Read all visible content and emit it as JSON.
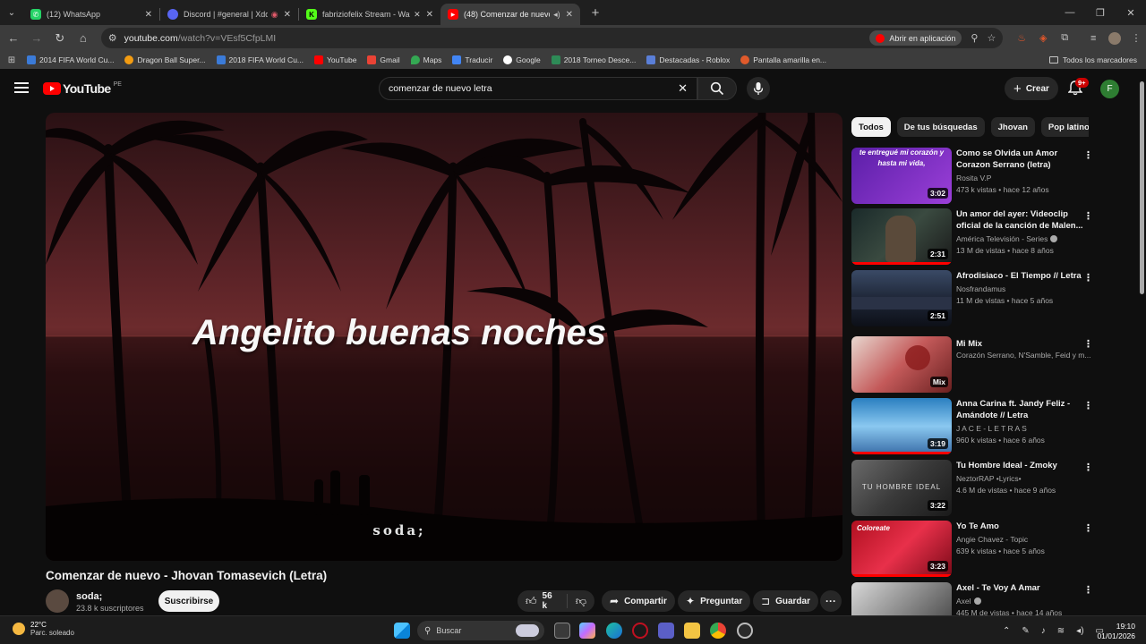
{
  "browser": {
    "tabs": [
      {
        "title": "(12) WhatsApp",
        "color": "#25d366",
        "glyph": "W",
        "extra": ""
      },
      {
        "title": "Discord | #general | Xddd",
        "color": "#5865f2",
        "glyph": "D",
        "extra": "◉"
      },
      {
        "title": "fabriziofelix Stream - Watch",
        "color": "#53fc18",
        "glyph": "K",
        "extra": "🔇"
      },
      {
        "title": "(48) Comenzar de nuevo - J",
        "color": "#ff0000",
        "glyph": "▶",
        "extra": "🔊"
      }
    ],
    "url_host": "youtube.com",
    "url_path": "/watch?v=VEsf5CfpLMI",
    "open_in_app": "Abrir en aplicación",
    "bookmarks": [
      {
        "label": "2014 FIFA World Cu...",
        "color": "#3b7bd8"
      },
      {
        "label": "Dragon Ball Super...",
        "color": "#f39c12"
      },
      {
        "label": "2018 FIFA World Cu...",
        "color": "#3b7bd8"
      },
      {
        "label": "YouTube",
        "color": "#ff0000"
      },
      {
        "label": "Gmail",
        "color": "#ea4335"
      },
      {
        "label": "Maps",
        "color": "#34a853"
      },
      {
        "label": "Traducir",
        "color": "#4285f4"
      },
      {
        "label": "Google",
        "color": "#ffffff"
      },
      {
        "label": "2018 Torneo Desce...",
        "color": "#2e8b57"
      },
      {
        "label": "Destacadas - Roblox",
        "color": "#5a7fd8"
      },
      {
        "label": "Pantalla amarilla en...",
        "color": "#e05a2b"
      }
    ],
    "all_bookmarks": "Todos los marcadores"
  },
  "youtube": {
    "logo": "YouTube",
    "country": "PE",
    "search_query": "comenzar de nuevo letra",
    "create_label": "Crear",
    "notifications": "9+",
    "avatar_letter": "F",
    "video": {
      "lyric": "Angelito buenas noches",
      "watermark": "soda;",
      "title": "Comenzar de nuevo - Jhovan Tomasevich (Letra)",
      "channel": "soda;",
      "subscribers": "23.8 k suscriptores",
      "subscribe_label": "Suscribirse",
      "likes": "56 k",
      "share_label": "Compartir",
      "ask_label": "Preguntar",
      "save_label": "Guardar"
    },
    "chips": [
      "Todos",
      "De tus búsquedas",
      "Jhovan",
      "Pop latino"
    ],
    "recommendations": [
      {
        "title": "Como se Olvida un Amor Corazon Serrano (letra) Primic...",
        "meta1": "Rosita V.P",
        "meta2": "473 k vistas • hace 12 años",
        "duration": "3:02",
        "verified": false,
        "thumb_bg": "linear-gradient(135deg,#5b1fa8,#9b3fd8)",
        "thumb_text": "te entregué mi corazón y hasta mi vida,"
      },
      {
        "title": "Un amor del ayer: Videoclip oficial de la canción de Malen...",
        "meta1": "América Televisión - Series",
        "meta2": "13 M de vistas • hace 8 años",
        "duration": "2:31",
        "verified": true,
        "thumb_bg": "linear-gradient(135deg,#1a2a2a,#3a4a40,#1a1a1a)",
        "thumb_text": ""
      },
      {
        "title": "Afrodisiaco - El Tiempo // Letra",
        "meta1": "Nosfrandamus",
        "meta2": "11 M de vistas • hace 5 años",
        "duration": "2:51",
        "verified": false,
        "thumb_bg": "linear-gradient(180deg,#3a4a66,#1f2738,#0d1018)",
        "thumb_text": ""
      },
      {
        "title": "Mi Mix",
        "meta1": "Corazón Serrano, N'Samble, Feid y m...",
        "meta2": "",
        "duration": "Mix",
        "verified": false,
        "thumb_bg": "linear-gradient(135deg,#e8d8d0,#c45a5a,#6a2020)",
        "thumb_text": ""
      },
      {
        "title": "Anna Carina ft. Jandy Feliz - Amándote // Letra",
        "meta1": "J A C E - L E T R A S",
        "meta2": "960 k vistas • hace 6 años",
        "duration": "3:19",
        "verified": false,
        "thumb_bg": "linear-gradient(180deg,#2a7fc0,#8ac8f0,#3a6ea8)",
        "thumb_text": ""
      },
      {
        "title": "Tu Hombre Ideal - Zmoky",
        "meta1": "NeztorRAP •Lyrics•",
        "meta2": "4.6 M de vistas • hace 9 años",
        "duration": "3:22",
        "verified": false,
        "thumb_bg": "linear-gradient(135deg,#6a6a6a,#3a3a3a,#1a1a1a)",
        "thumb_text": "TU HOMBRE IDEAL"
      },
      {
        "title": "Yo Te Amo",
        "meta1": "Angie Chavez - Topic",
        "meta2": "639 k vistas • hace 5 años",
        "duration": "3:23",
        "verified": false,
        "thumb_bg": "linear-gradient(135deg,#b01020,#e8304a,#7a0a18)",
        "thumb_text": "Coloreate"
      },
      {
        "title": "Axel - Te Voy A Amar",
        "meta1": "Axel",
        "meta2": "445 M de vistas • hace 14 años",
        "duration": "",
        "verified": true,
        "thumb_bg": "linear-gradient(135deg,#d8d8d8,#8a8a8a,#3a3a3a)",
        "thumb_text": ""
      }
    ]
  },
  "taskbar": {
    "temperature": "22°C",
    "condition": "Parc. soleado",
    "search_placeholder": "Buscar",
    "time": "19:10",
    "date": "01/01/2026"
  }
}
